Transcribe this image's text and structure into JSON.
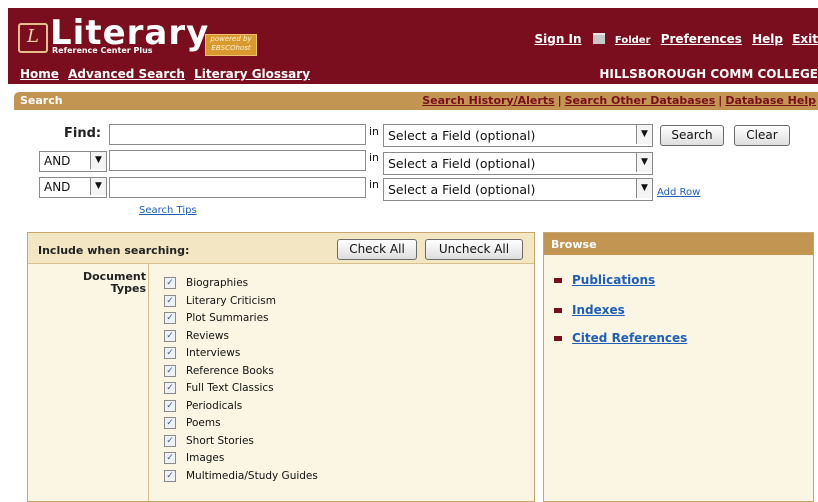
{
  "header": {
    "logo_mark": "L",
    "logo_text": "Literary",
    "logo_subtitle": "Reference Center Plus",
    "powered_by": "powered by EBSCOhost",
    "top_links": {
      "sign_in": "Sign In",
      "folder": "Folder",
      "preferences": "Preferences",
      "help": "Help",
      "exit": "Exit"
    },
    "nav": {
      "home": "Home",
      "advanced_search": "Advanced Search",
      "glossary": "Literary Glossary"
    },
    "institution": "HILLSBOROUGH COMM COLLEGE"
  },
  "search_bar": {
    "title": "Search",
    "links": {
      "history": "Search History/Alerts",
      "other_db": "Search Other Databases",
      "db_help": "Database Help"
    },
    "separator": "|"
  },
  "search_form": {
    "find_label": "Find:",
    "in_label": "in",
    "field_placeholder": "Select a Field (optional)",
    "operators": [
      "AND",
      "AND"
    ],
    "search_button": "Search",
    "clear_button": "Clear",
    "add_row": "Add Row",
    "search_tips": "Search Tips"
  },
  "include": {
    "title": "Include when searching:",
    "check_all": "Check All",
    "uncheck_all": "Uncheck All",
    "doc_types_label": "Document Types",
    "items": [
      {
        "label": "Biographies",
        "checked": true
      },
      {
        "label": "Literary Criticism",
        "checked": true
      },
      {
        "label": "Plot Summaries",
        "checked": true
      },
      {
        "label": "Reviews",
        "checked": true
      },
      {
        "label": "Interviews",
        "checked": true
      },
      {
        "label": "Reference Books",
        "checked": true
      },
      {
        "label": "Full Text Classics",
        "checked": true
      },
      {
        "label": "Periodicals",
        "checked": true
      },
      {
        "label": "Poems",
        "checked": true
      },
      {
        "label": "Short Stories",
        "checked": true
      },
      {
        "label": "Images",
        "checked": true
      },
      {
        "label": "Multimedia/Study Guides",
        "checked": true
      }
    ]
  },
  "browse": {
    "title": "Browse",
    "items": [
      "Publications",
      "Indexes",
      "Cited References"
    ]
  },
  "colors": {
    "header_bg": "#7a0e1e",
    "bar_tan": "#c39553",
    "panel_bg": "#fbf6e4",
    "link_blue": "#1f5fb8"
  },
  "icons": [
    "folder-icon",
    "dropdown-arrow-icon",
    "checkbox-icon",
    "bullet-icon"
  ]
}
